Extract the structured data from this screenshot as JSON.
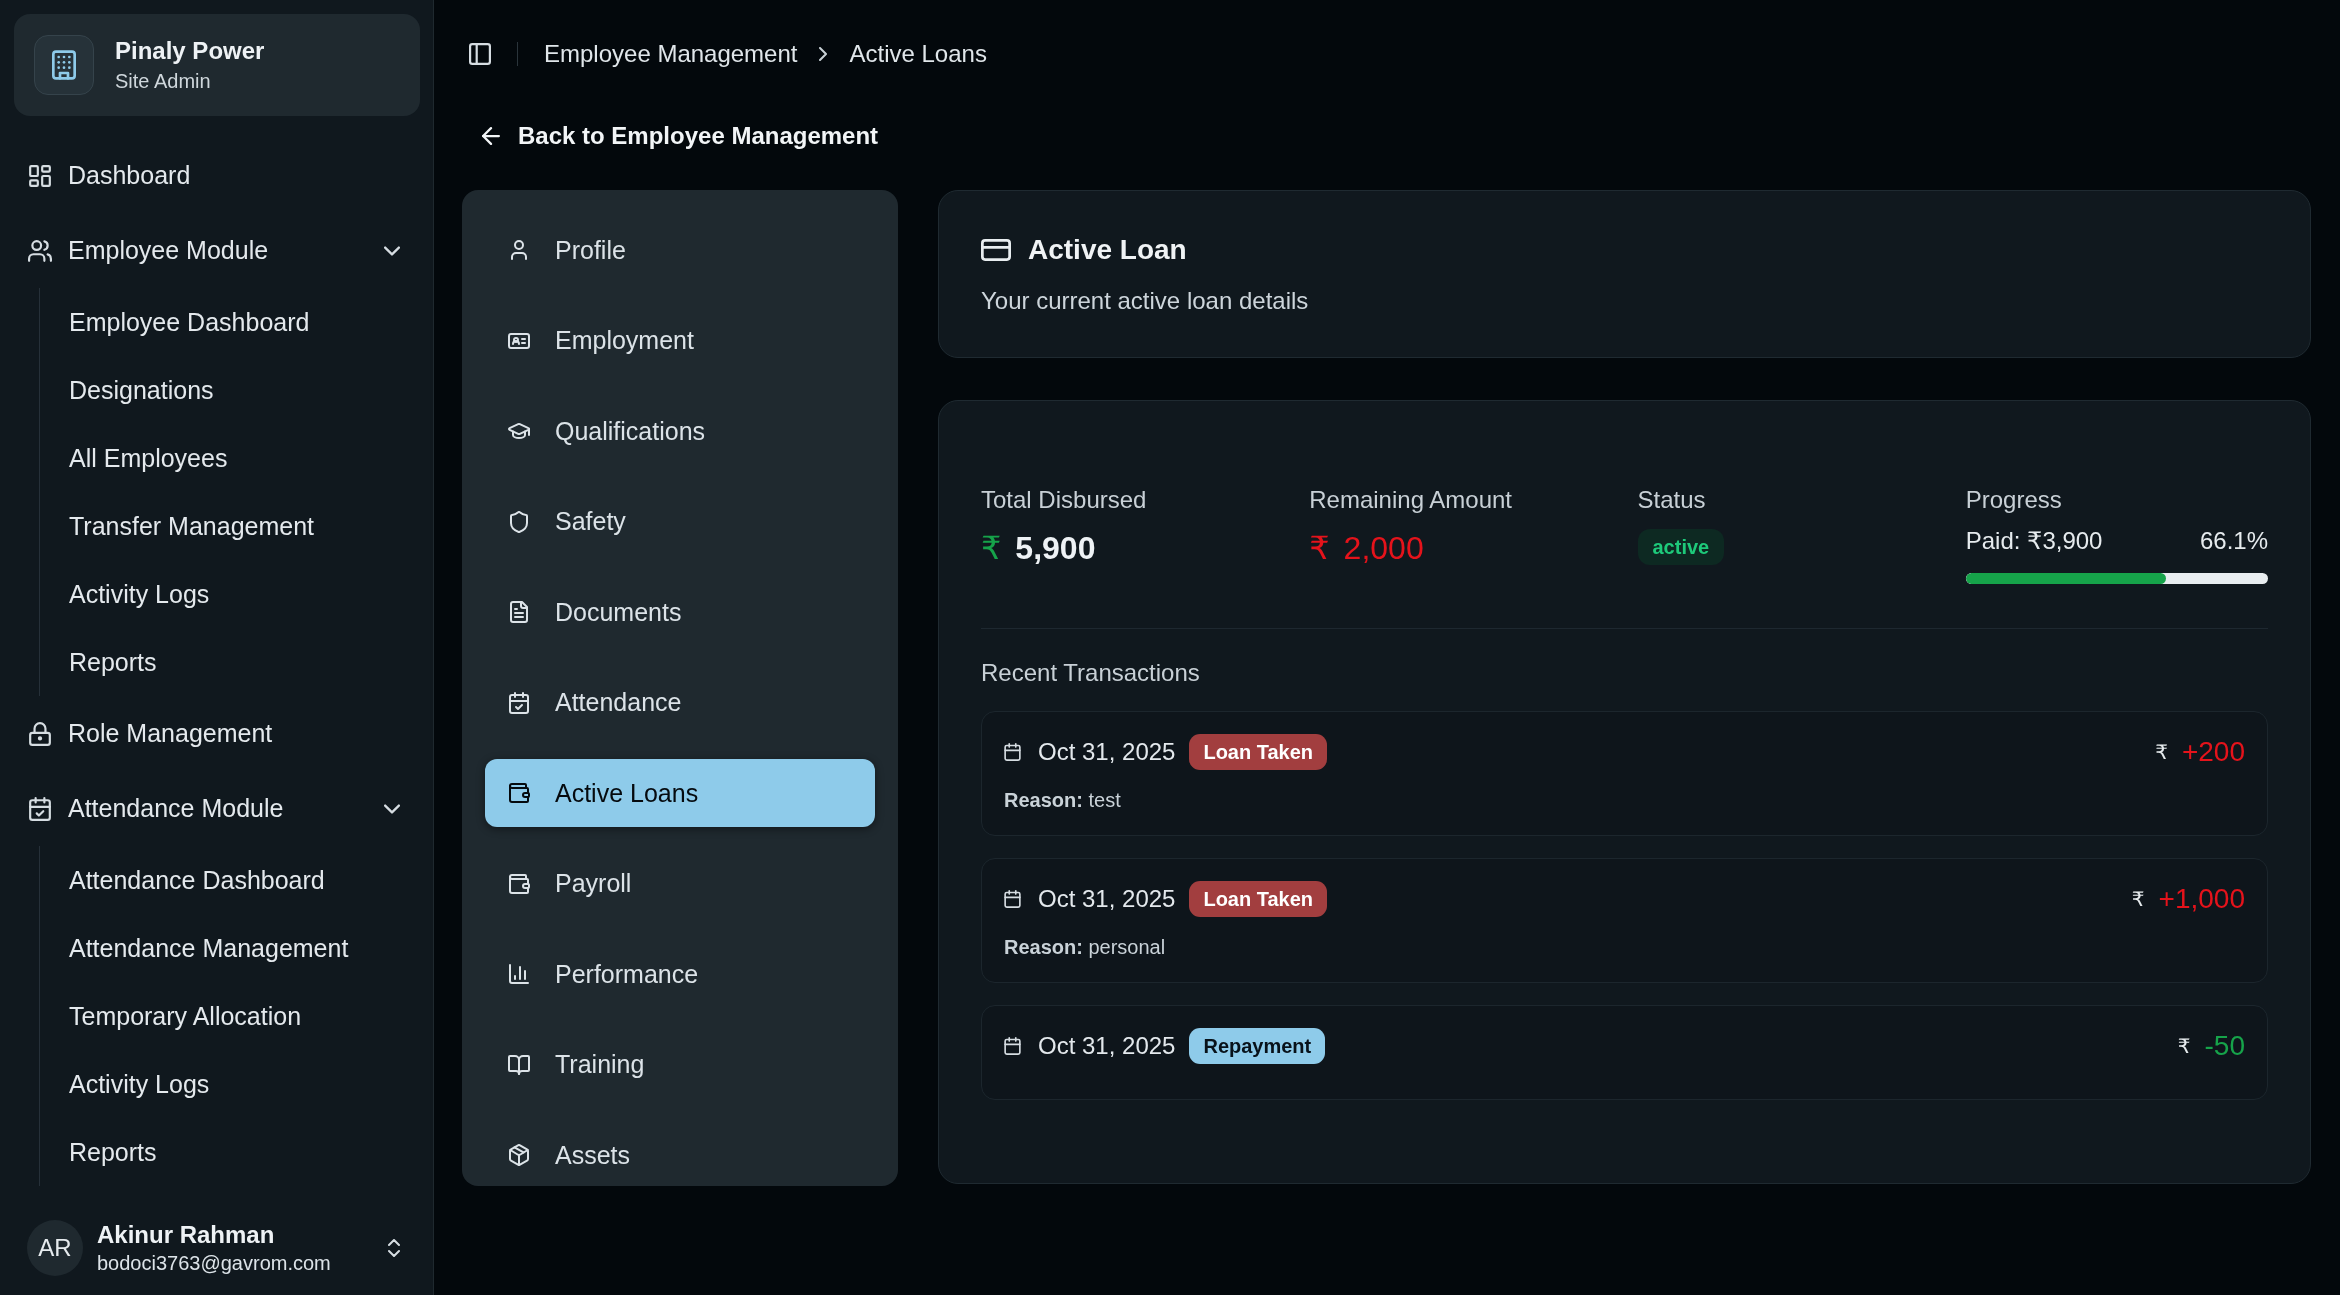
{
  "sidebar": {
    "brand": {
      "name": "Pinaly Power",
      "role": "Site Admin"
    },
    "items": [
      {
        "label": "Dashboard"
      },
      {
        "label": "Employee Module",
        "expanded": true,
        "children": [
          {
            "label": "Employee Dashboard"
          },
          {
            "label": "Designations"
          },
          {
            "label": "All Employees"
          },
          {
            "label": "Transfer Management"
          },
          {
            "label": "Activity Logs"
          },
          {
            "label": "Reports"
          }
        ]
      },
      {
        "label": "Role Management"
      },
      {
        "label": "Attendance Module",
        "expanded": true,
        "children": [
          {
            "label": "Attendance Dashboard"
          },
          {
            "label": "Attendance Management"
          },
          {
            "label": "Temporary Allocation"
          },
          {
            "label": "Activity Logs"
          },
          {
            "label": "Reports"
          }
        ]
      }
    ],
    "user": {
      "initials": "AR",
      "name": "Akinur Rahman",
      "email": "bodoci3763@gavrom.com"
    }
  },
  "breadcrumb": [
    {
      "label": "Employee Management"
    },
    {
      "label": "Active Loans"
    }
  ],
  "back_link": "Back to Employee Management",
  "profile_nav": {
    "items": [
      {
        "label": "Profile",
        "selected": false
      },
      {
        "label": "Employment",
        "selected": false
      },
      {
        "label": "Qualifications",
        "selected": false
      },
      {
        "label": "Safety",
        "selected": false
      },
      {
        "label": "Documents",
        "selected": false
      },
      {
        "label": "Attendance",
        "selected": false
      },
      {
        "label": "Active Loans",
        "selected": true
      },
      {
        "label": "Payroll",
        "selected": false
      },
      {
        "label": "Performance",
        "selected": false
      },
      {
        "label": "Training",
        "selected": false
      },
      {
        "label": "Assets",
        "selected": false
      }
    ]
  },
  "loan_card": {
    "title": "Active Loan",
    "subtitle": "Your current active loan details"
  },
  "details": {
    "stats": [
      {
        "kind": "total",
        "label": "Total Disbursed",
        "currency": "₹",
        "value": "5,900"
      },
      {
        "kind": "remaining",
        "label": "Remaining Amount",
        "currency": "₹",
        "value": "2,000"
      },
      {
        "kind": "status",
        "label": "Status",
        "value": "active"
      },
      {
        "kind": "progress",
        "label": "Progress",
        "paid": "Paid: ₹3,900",
        "percent": "66.1%",
        "level": 0.661
      }
    ],
    "transactions_title": "Recent Transactions",
    "transactions": [
      {
        "kind": "loan",
        "date": "Oct 31, 2025",
        "type": "Loan Taken",
        "currency": "₹",
        "amount": "+200",
        "reason": "**Reason:** test"
      },
      {
        "kind": "loan",
        "date": "Oct 31, 2025",
        "type": "Loan Taken",
        "currency": "₹",
        "amount": "+1,000",
        "reason": "**Reason:** personal"
      },
      {
        "kind": "repayment",
        "date": "Oct 31, 2025",
        "type": "Repayment",
        "currency": "₹",
        "amount": "-50"
      }
    ]
  }
}
